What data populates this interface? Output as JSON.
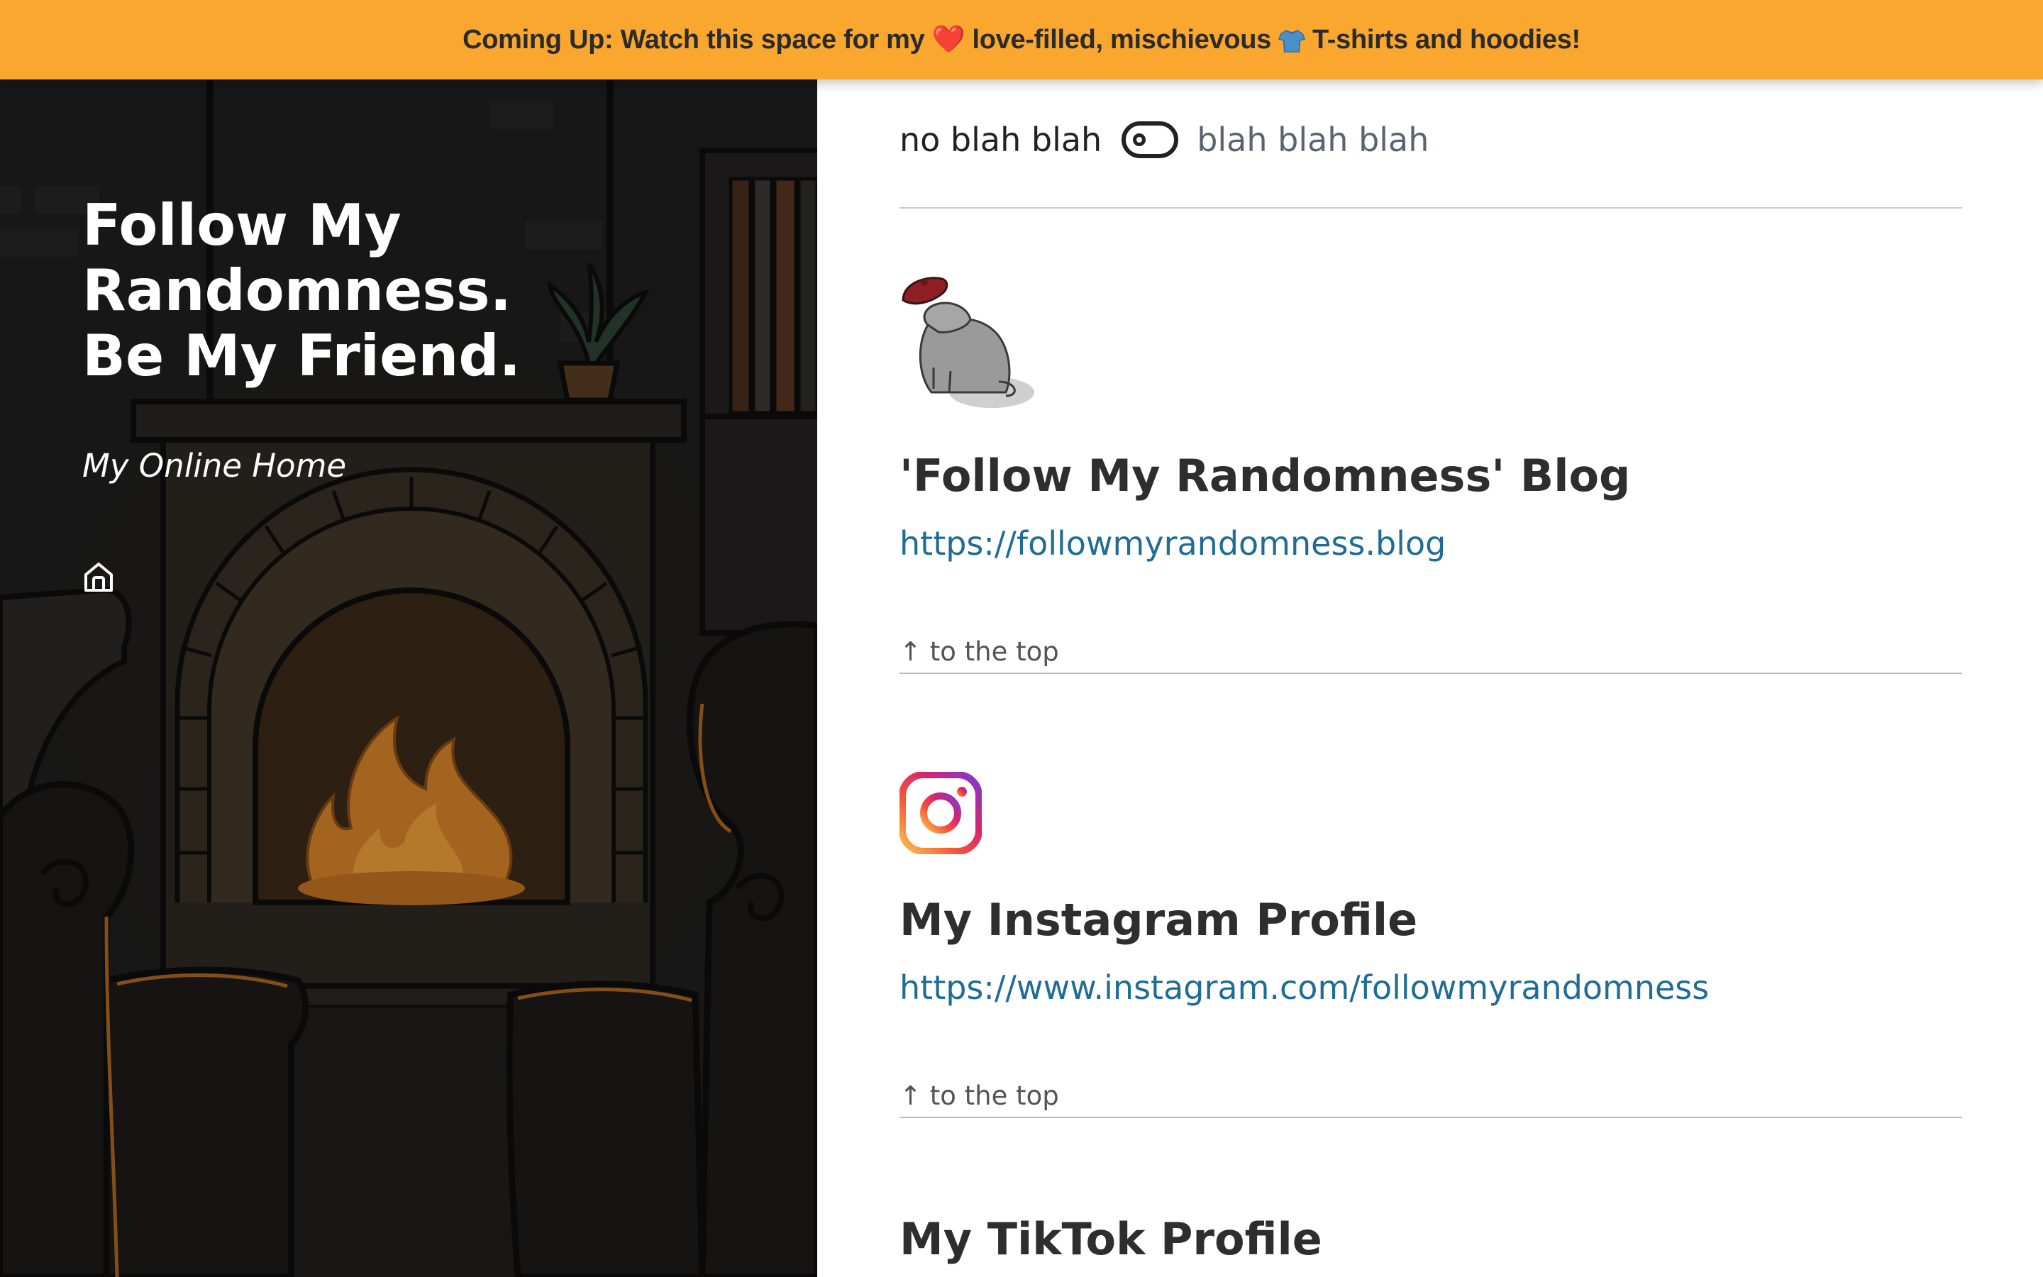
{
  "banner": {
    "prefix": "Coming Up: Watch this space for my",
    "heart_emoji": "❤️",
    "middle": "love-filled, mischievous",
    "shirt_icon": "tshirt-emoji",
    "suffix": "T-shirts and hoodies!",
    "background_color": "#f9a72e"
  },
  "hero": {
    "title": "Follow My Randomness. Be My Friend.",
    "tagline": "My Online Home",
    "home_icon": "home-icon"
  },
  "toggle": {
    "off_label": "no blah blah",
    "on_label": "blah blah blah",
    "state": "off"
  },
  "entries": [
    {
      "icon": "cat-with-hat-icon",
      "title": "'Follow My Randomness' Blog",
      "url": "https://followmyrandomness.blog",
      "to_top": "↑ to the top"
    },
    {
      "icon": "instagram-icon",
      "title": "My Instagram Profile",
      "url": "https://www.instagram.com/followmyrandomness",
      "to_top": "↑ to the top"
    },
    {
      "title": "My TikTok Profile"
    }
  ],
  "colors": {
    "link": "#1f6c96",
    "heading": "#2e2e2e",
    "hero_bg": "#1d1d1d"
  }
}
